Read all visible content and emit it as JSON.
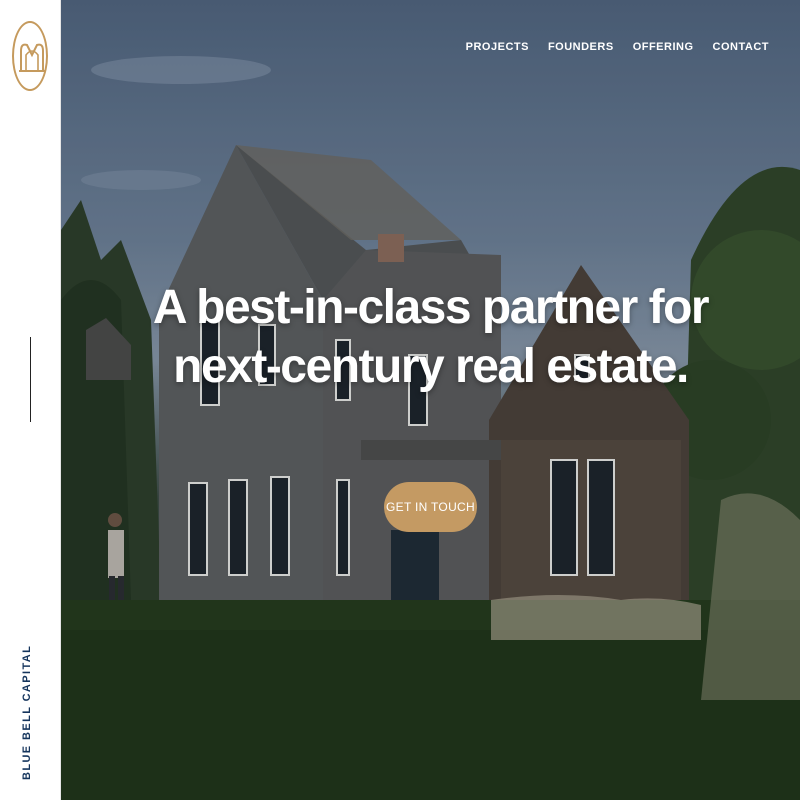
{
  "brand": {
    "name": "BLUE BELL CAPITAL",
    "logo_icon": "bell-monogram-icon",
    "accent_color": "#c59a5d",
    "brand_color": "#14345c"
  },
  "nav": {
    "items": [
      {
        "label": "PROJECTS"
      },
      {
        "label": "FOUNDERS"
      },
      {
        "label": "OFFERING"
      },
      {
        "label": "CONTACT"
      }
    ]
  },
  "hero": {
    "headline_line1": "A best-in-class partner for",
    "headline_line2": "next-century real estate.",
    "cta_label": "GET IN TOUCH",
    "cta_color": "#c49a63"
  }
}
